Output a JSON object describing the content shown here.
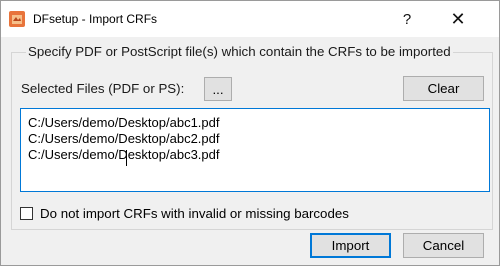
{
  "window": {
    "title": "DFsetup - Import CRFs",
    "help_label": "?",
    "close_label": "✕"
  },
  "group": {
    "title": "Specify PDF or PostScript file(s) which contain the CRFs to be imported"
  },
  "files": {
    "label": "Selected Files (PDF or PS):",
    "browse_label": "...",
    "clear_label": "Clear",
    "list": [
      "C:/Users/demo/Desktop/abc1.pdf",
      "C:/Users/demo/Desktop/abc2.pdf",
      "C:/Users/demo/Desktop/abc3.pdf"
    ]
  },
  "options": {
    "skip_invalid_label": "Do not import CRFs with invalid or missing barcodes",
    "skip_invalid_checked": false
  },
  "actions": {
    "import_label": "Import",
    "cancel_label": "Cancel"
  },
  "colors": {
    "focus_accent": "#0078d7",
    "app_icon": "#e8743b"
  }
}
